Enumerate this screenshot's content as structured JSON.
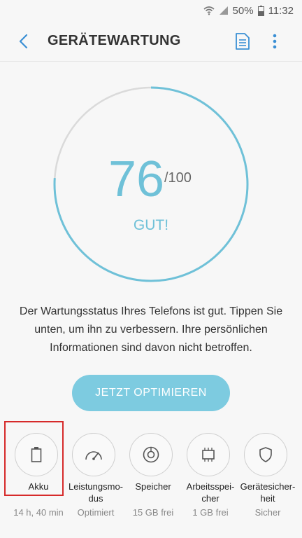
{
  "status_bar": {
    "battery_percent": "50%",
    "time": "11:32"
  },
  "app_bar": {
    "title": "GERÄTEWARTUNG",
    "back_icon": "chevron-left-icon",
    "report_icon": "document-icon",
    "more_icon": "more-vert-icon"
  },
  "score": {
    "value": "76",
    "max": "/100",
    "status": "GUT!",
    "progress": 0.76,
    "accent_color": "#6fc1d8"
  },
  "description": "Der Wartungsstatus Ihres Telefons ist gut. Tippen Sie unten, um ihn zu verbessern. Ihre persönlichen Informationen sind davon nicht betroffen.",
  "optimize_button": "JETZT OPTIMIEREN",
  "categories": [
    {
      "label": "Akku",
      "sub": "14 h, 40 min",
      "icon": "battery-icon"
    },
    {
      "label": "Leistungsmo-\ndus",
      "sub": "Optimiert",
      "icon": "speedometer-icon"
    },
    {
      "label": "Speicher",
      "sub": "15 GB frei",
      "icon": "storage-disc-icon"
    },
    {
      "label": "Arbeitsspei-\ncher",
      "sub": "1 GB frei",
      "icon": "memory-chip-icon"
    },
    {
      "label": "Gerätesicher-\nheit",
      "sub": "Sicher",
      "icon": "shield-icon"
    }
  ]
}
